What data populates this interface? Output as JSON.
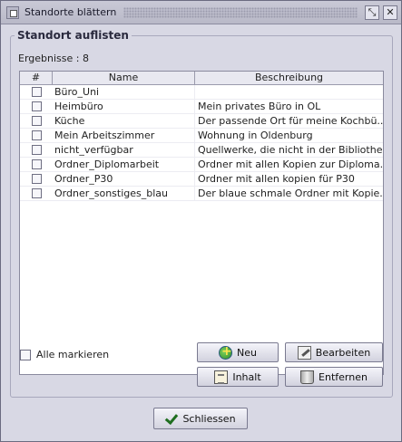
{
  "window": {
    "title": "Standorte blättern",
    "restore_symbol": "⤡",
    "close_symbol": "✕"
  },
  "group": {
    "title": "Standort auflisten",
    "result_label": "Ergebnisse : 8"
  },
  "table": {
    "columns": [
      "#",
      "Name",
      "Beschreibung"
    ],
    "rows": [
      {
        "name": "Büro_Uni",
        "description": "",
        "checked": false
      },
      {
        "name": "Heimbüro",
        "description": "Mein privates Büro in OL",
        "checked": false
      },
      {
        "name": "Küche",
        "description": "Der passende Ort für meine Kochbü...",
        "checked": false
      },
      {
        "name": "Mein Arbeitszimmer",
        "description": "Wohnung in Oldenburg",
        "checked": false
      },
      {
        "name": "nicht_verfügbar",
        "description": "Quellwerke, die nicht in der Bibliothe...",
        "checked": false
      },
      {
        "name": "Ordner_Diplomarbeit",
        "description": "Ordner mit allen Kopien zur Diploma...",
        "checked": false
      },
      {
        "name": "Ordner_P30",
        "description": "Ordner mit allen kopien für P30",
        "checked": false
      },
      {
        "name": "Ordner_sonstiges_blau",
        "description": "Der blaue schmale Ordner mit Kopie...",
        "checked": false
      }
    ]
  },
  "mark_all_label": "Alle markieren",
  "buttons": {
    "new": "Neu",
    "edit": "Bearbeiten",
    "content": "Inhalt",
    "delete": "Entfernen",
    "close": "Schliessen"
  },
  "icons": {
    "new": "add-icon",
    "edit": "edit-icon",
    "content": "clipboard-icon",
    "delete": "trash-icon",
    "close": "checkmark-icon"
  }
}
